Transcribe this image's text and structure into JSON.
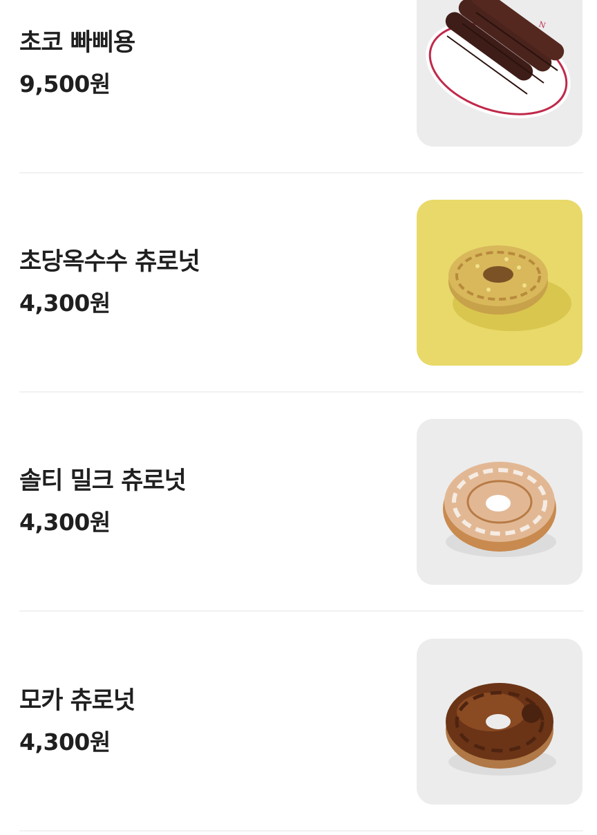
{
  "menu": {
    "items": [
      {
        "name": "초코 빠삐용",
        "price": "9,500원",
        "image": "chocolate-churros-on-plate"
      },
      {
        "name": "초당옥수수 츄로넛",
        "price": "4,300원",
        "image": "corn-churro-donut"
      },
      {
        "name": "솔티 밀크 츄로넛",
        "price": "4,300원",
        "image": "salty-milk-churro-donut"
      },
      {
        "name": "모카 츄로넛",
        "price": "4,300원",
        "image": "mocha-churro-donut"
      }
    ]
  },
  "colors": {
    "text": "#1f1f1f",
    "divider": "#f1f1f1",
    "thumb_background_gray": "#ececec",
    "thumb_background_yellow": "#e8d96a"
  }
}
